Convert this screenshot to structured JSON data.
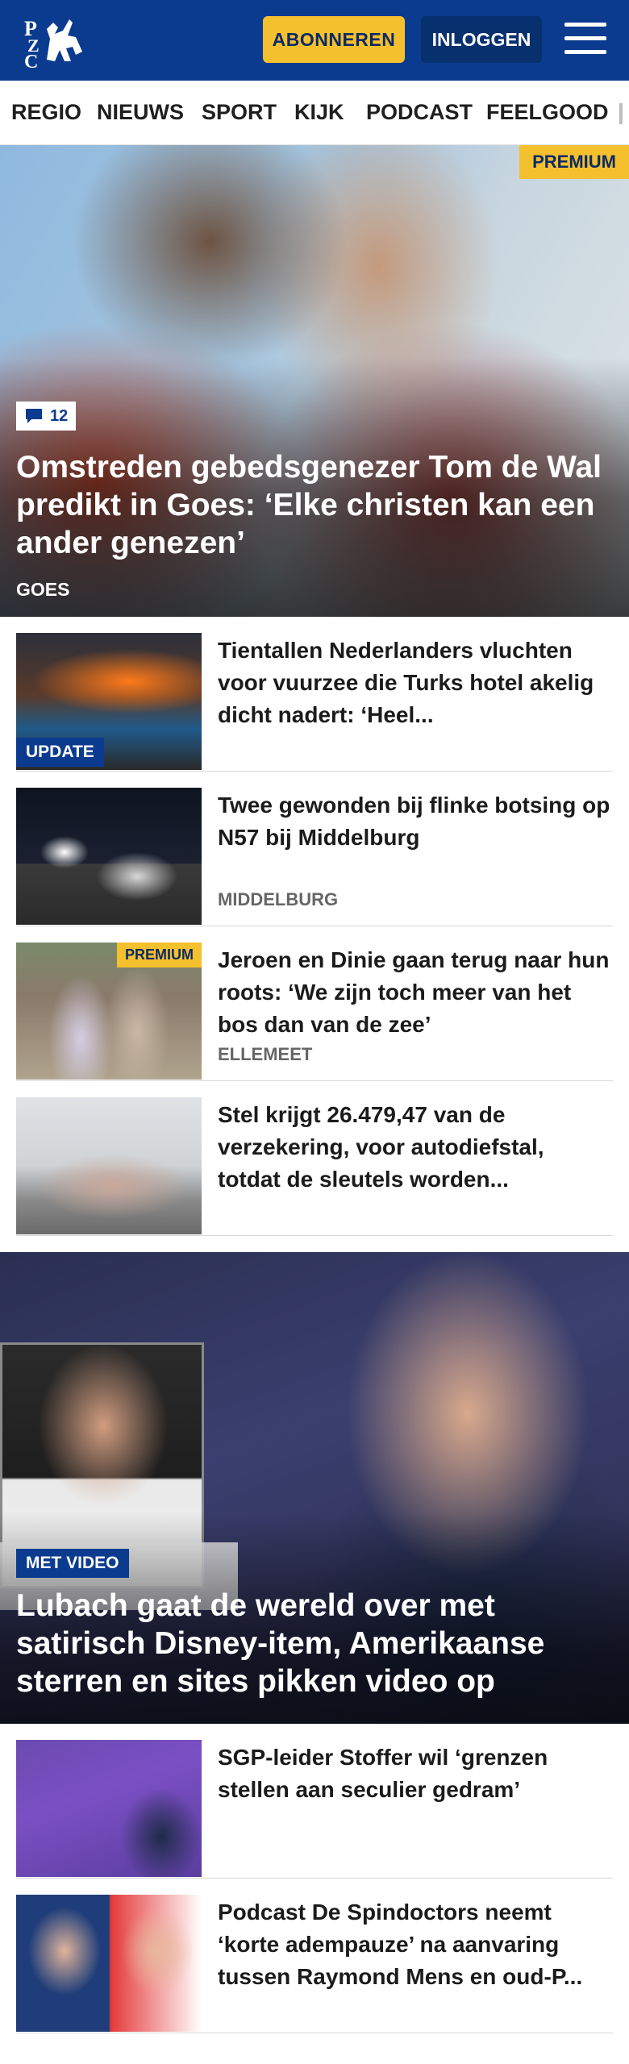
{
  "header": {
    "logo_text": "PZC",
    "subscribe_label": "ABONNEREN",
    "login_label": "INLOGGEN",
    "menu_icon": "hamburger-menu-icon"
  },
  "nav": {
    "items": [
      "REGIO",
      "NIEUWS",
      "SPORT",
      "KIJK",
      "PODCAST",
      "FEELGOOD"
    ]
  },
  "hero": {
    "premium_label": "PREMIUM",
    "comment_count": "12",
    "title": "Omstreden gebedsgenezer Tom de Wal predikt in Goes: ‘Elke christen kan een ander genezen’",
    "location": "GOES"
  },
  "articles": [
    {
      "title": "Tientallen Nederlanders vluchten voor vuurzee die Turks hotel akelig dicht nadert: ‘Heel...",
      "badge": "UPDATE"
    },
    {
      "title": "Twee gewonden bij flinke botsing op N57 bij Middelburg",
      "location": "MIDDELBURG"
    },
    {
      "title": "Jeroen en Dinie gaan terug naar hun roots: ‘We zijn toch meer van het bos dan van de zee’",
      "location": "ELLEMEET",
      "badge": "PREMIUM"
    },
    {
      "title": "Stel krijgt 26.479,47 van de verzekering, voor autodiefstal, totdat de sleutels worden..."
    }
  ],
  "feature": {
    "badge": "MET VIDEO",
    "title": "Lubach gaat de wereld over met satirisch Disney-item, Amerikaanse sterren en sites pikken video op"
  },
  "articles_2": [
    {
      "title": "SGP-leider Stoffer wil ‘grenzen stellen aan seculier gedram’"
    },
    {
      "title": "Podcast De Spindoctors neemt ‘korte adempauze’ na aanvaring tussen Raymond Mens en oud-P..."
    }
  ],
  "colors": {
    "brand_blue": "#0b3b8f",
    "accent_yellow": "#f5c02e"
  }
}
